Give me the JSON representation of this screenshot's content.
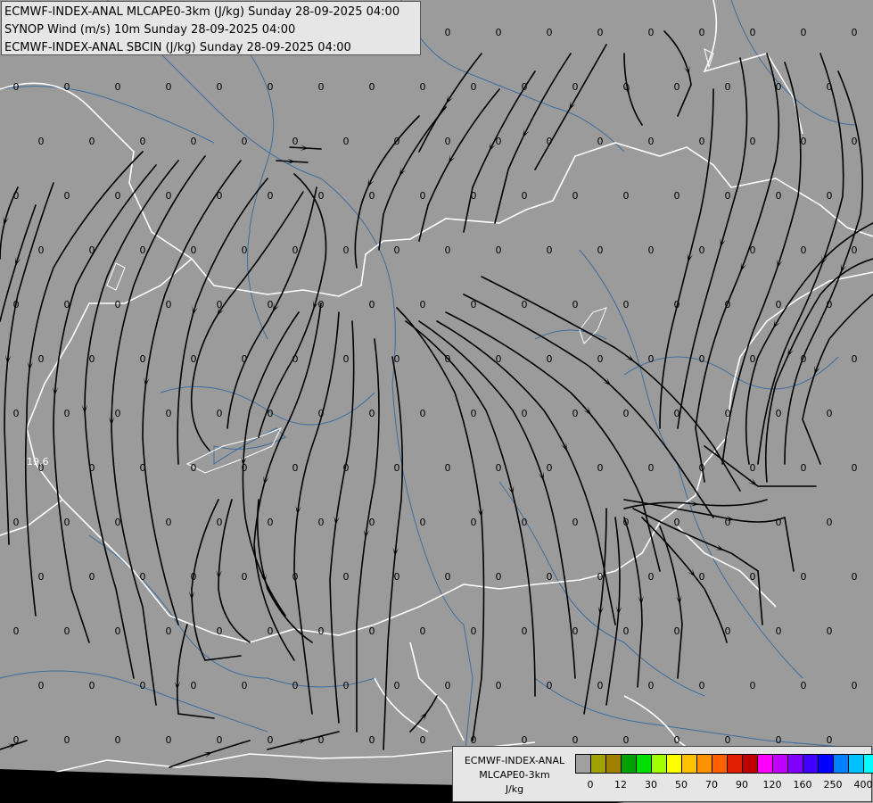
{
  "header": {
    "line1": "ECMWF-INDEX-ANAL MLCAPE0-3km (J/kg) Sunday 28-09-2025 04:00",
    "line2": "SYNOP Wind (m/s) 10m Sunday 28-09-2025 04:00",
    "line3": "ECMWF-INDEX-ANAL SBCIN (J/kg) Sunday 28-09-2025 04:00"
  },
  "legend": {
    "title_line1": "ECMWF-INDEX-ANAL",
    "title_line2": "MLCAPE0-3km",
    "title_line3": "J/kg",
    "colors": [
      "#a0a0a0",
      "#a0a000",
      "#a08000",
      "#00a000",
      "#00e000",
      "#a0ff00",
      "#ffff00",
      "#ffc000",
      "#ff9000",
      "#ff6000",
      "#e02000",
      "#c00000",
      "#ff00ff",
      "#c000ff",
      "#8000ff",
      "#4000ff",
      "#0000ff",
      "#0080ff",
      "#00c0ff",
      "#00ffff",
      "#80ffff",
      "#ffffff"
    ],
    "ticks": [
      "0",
      "12",
      "30",
      "50",
      "70",
      "90",
      "120",
      "160",
      "250",
      "400"
    ]
  },
  "map": {
    "background": "#9b9b9b",
    "border_color": "#ffffff",
    "river_color": "#3e6e9e",
    "streamline_color": "#000000",
    "value_label": "0",
    "cin_label": "19.6",
    "colors_note": "grey = 0 J/kg"
  }
}
